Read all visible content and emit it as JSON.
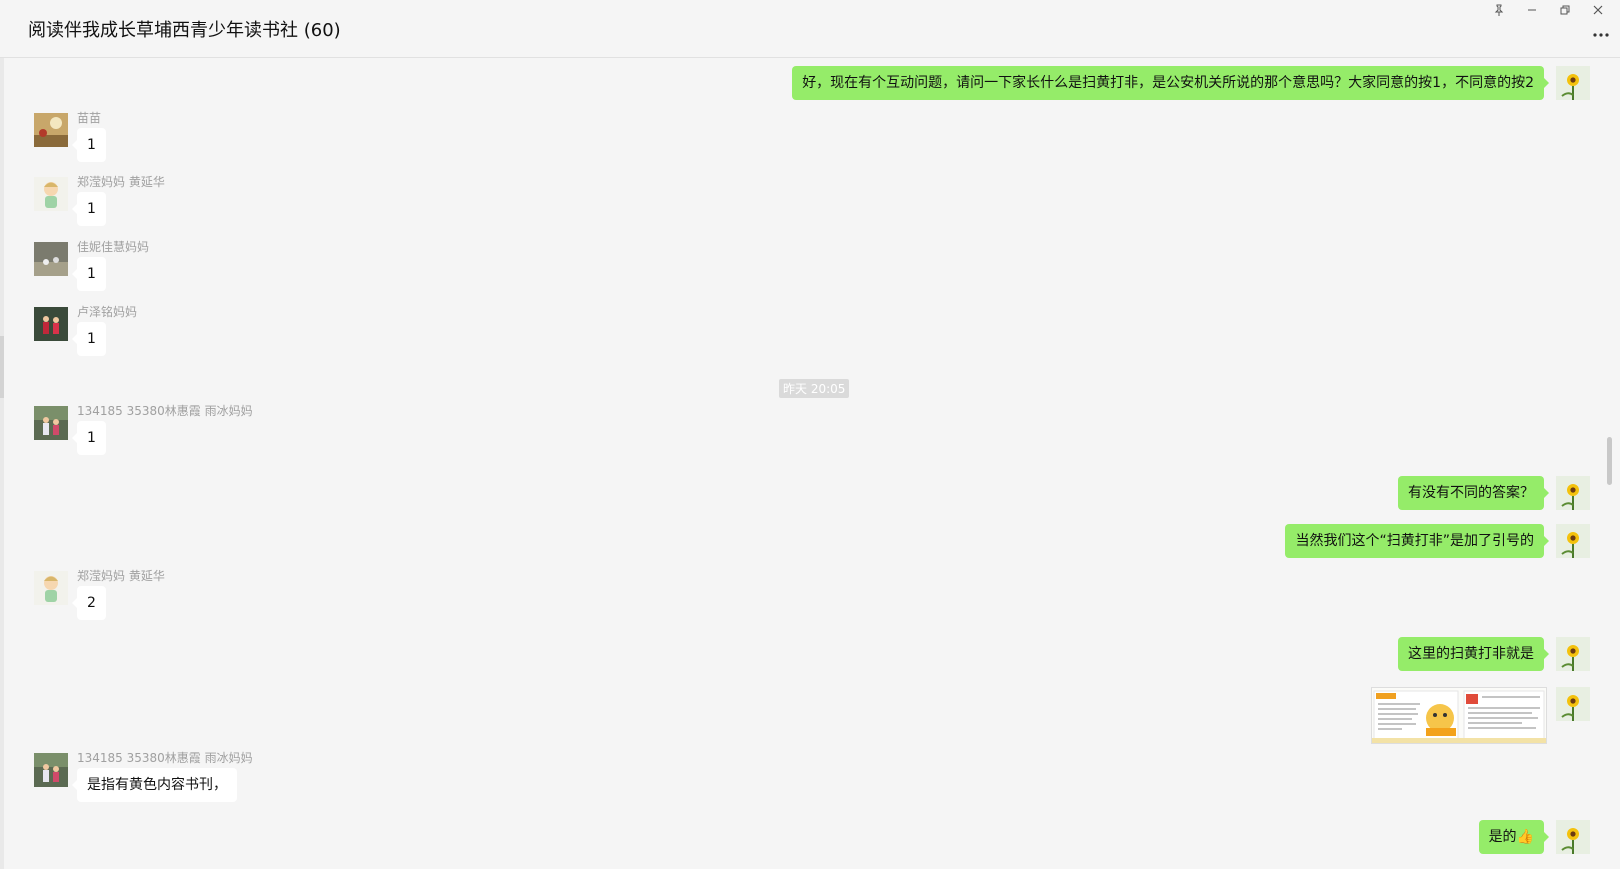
{
  "window": {
    "title": "阅读伴我成长草埔西青少年读书社 (60)",
    "pin_icon": "pin-icon",
    "minimize_icon": "minimize-icon",
    "restore_icon": "restore-icon",
    "close_icon": "close-icon",
    "more_icon": "more-icon"
  },
  "chat": {
    "timestamp": "昨天 20:05",
    "messages": [
      {
        "dir": "out",
        "text": "好，现在有个互动问题，请问一下家长什么是扫黄打非，是公安机关所说的那个意思吗？大家同意的按1，不同意的按2"
      },
      {
        "dir": "in",
        "sender": "苗苗",
        "text": "1"
      },
      {
        "dir": "in",
        "sender": "郑滢妈妈 黄延华",
        "text": "1"
      },
      {
        "dir": "in",
        "sender": "佳妮佳慧妈妈",
        "text": "1"
      },
      {
        "dir": "in",
        "sender": "卢泽铭妈妈",
        "text": "1"
      },
      {
        "dir": "in",
        "sender": "134185 35380林惠霞 雨冰妈妈",
        "text": "1"
      },
      {
        "dir": "out",
        "text": "有没有不同的答案？"
      },
      {
        "dir": "out",
        "text": "当然我们这个“扫黄打非”是加了引号的"
      },
      {
        "dir": "in",
        "sender": "郑滢妈妈 黄延华",
        "text": "2"
      },
      {
        "dir": "out",
        "text": "这里的扫黄打非就是"
      },
      {
        "dir": "out",
        "type": "image",
        "text": ""
      },
      {
        "dir": "in",
        "sender": "134185 35380林惠霞 雨冰妈妈",
        "text": "是指有黄色内容书刊，"
      },
      {
        "dir": "out",
        "text": "是的👍"
      }
    ]
  },
  "colors": {
    "out_bubble": "#95ec69",
    "in_bubble": "#ffffff",
    "background": "#f5f5f5"
  }
}
